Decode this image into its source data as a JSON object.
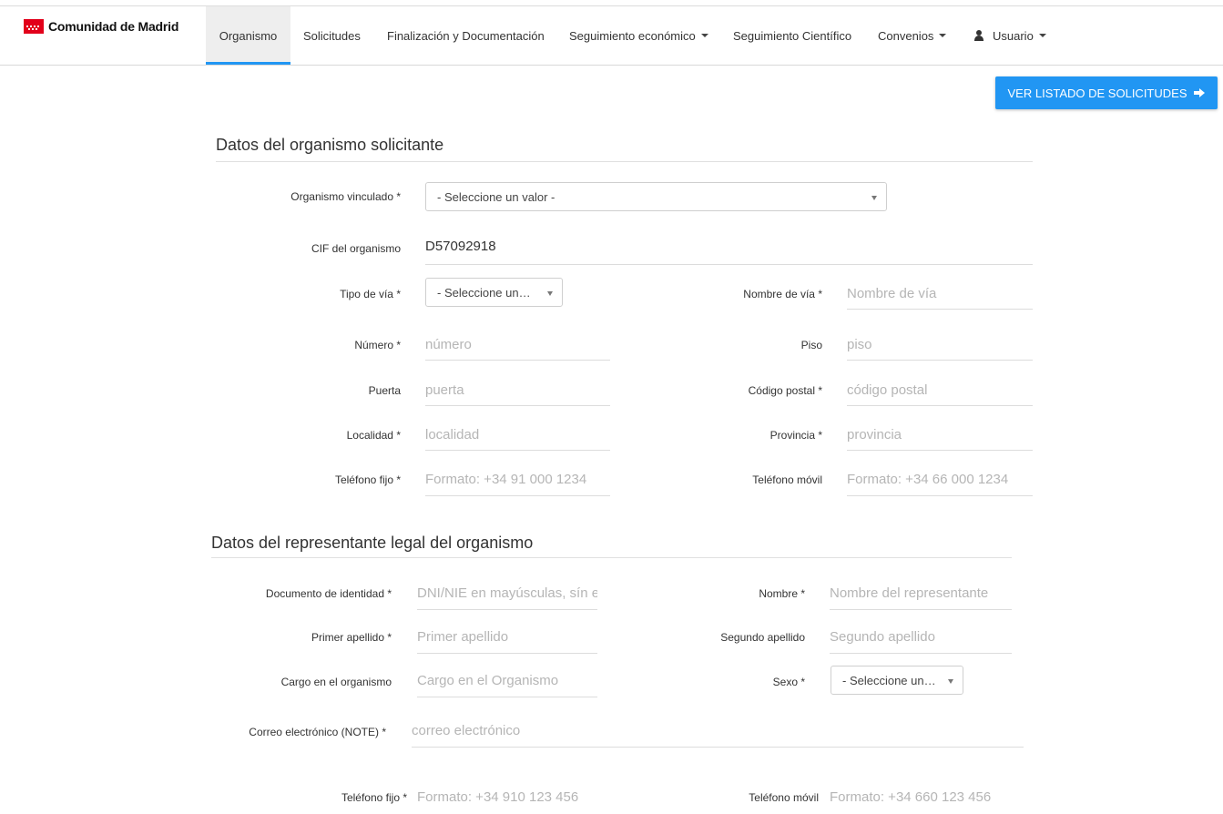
{
  "brand": {
    "name": "Comunidad de Madrid"
  },
  "nav": {
    "organismo": "Organismo",
    "solicitudes": "Solicitudes",
    "finalizacion": "Finalización y Documentación",
    "seguimiento_economico": "Seguimiento económico",
    "seguimiento_cientifico": "Seguimiento Científico",
    "convenios": "Convenios",
    "usuario": "Usuario"
  },
  "actions": {
    "ver_listado": "VER LISTADO DE SOLICITUDES"
  },
  "colors": {
    "accent": "#2196f3",
    "brand_red": "#e2001a"
  },
  "section1": {
    "title": "Datos del organismo solicitante",
    "organismo_vinculado": {
      "label": "Organismo vinculado *",
      "value": "- Seleccione un valor -"
    },
    "cif": {
      "label": "CIF del organismo",
      "value": "D57092918"
    },
    "tipo_via": {
      "label": "Tipo de vía *",
      "value": "- Seleccione un…"
    },
    "nombre_via": {
      "label": "Nombre de vía *",
      "placeholder": "Nombre de vía"
    },
    "numero": {
      "label": "Número *",
      "placeholder": "número"
    },
    "piso": {
      "label": "Piso",
      "placeholder": "piso"
    },
    "puerta": {
      "label": "Puerta",
      "placeholder": "puerta"
    },
    "codigo_postal": {
      "label": "Código postal *",
      "placeholder": "código postal"
    },
    "localidad": {
      "label": "Localidad *",
      "placeholder": "localidad"
    },
    "provincia": {
      "label": "Provincia *",
      "placeholder": "provincia"
    },
    "telefono_fijo": {
      "label": "Teléfono fijo *",
      "placeholder": "Formato: +34 91 000 1234"
    },
    "telefono_movil": {
      "label": "Teléfono móvil",
      "placeholder": "Formato: +34 66 000 1234"
    }
  },
  "section2": {
    "title": "Datos del representante legal del organismo",
    "documento": {
      "label": "Documento de identidad *",
      "placeholder": "DNI/NIE en mayúsculas, sín e"
    },
    "nombre": {
      "label": "Nombre *",
      "placeholder": "Nombre del representante"
    },
    "primer_apellido": {
      "label": "Primer apellido *",
      "placeholder": "Primer apellido"
    },
    "segundo_apellido": {
      "label": "Segundo apellido",
      "placeholder": "Segundo apellido"
    },
    "cargo": {
      "label": "Cargo en el organismo",
      "placeholder": "Cargo en el Organismo"
    },
    "sexo": {
      "label": "Sexo *",
      "value": "- Seleccione un…"
    },
    "correo": {
      "label": "Correo electrónico (NOTE) *",
      "placeholder": "correo electrónico"
    },
    "telefono_fijo": {
      "label": "Teléfono fijo *",
      "placeholder": "Formato: +34 910 123 456"
    },
    "telefono_movil": {
      "label": "Teléfono móvil",
      "placeholder": "Formato: +34 660 123 456"
    }
  }
}
